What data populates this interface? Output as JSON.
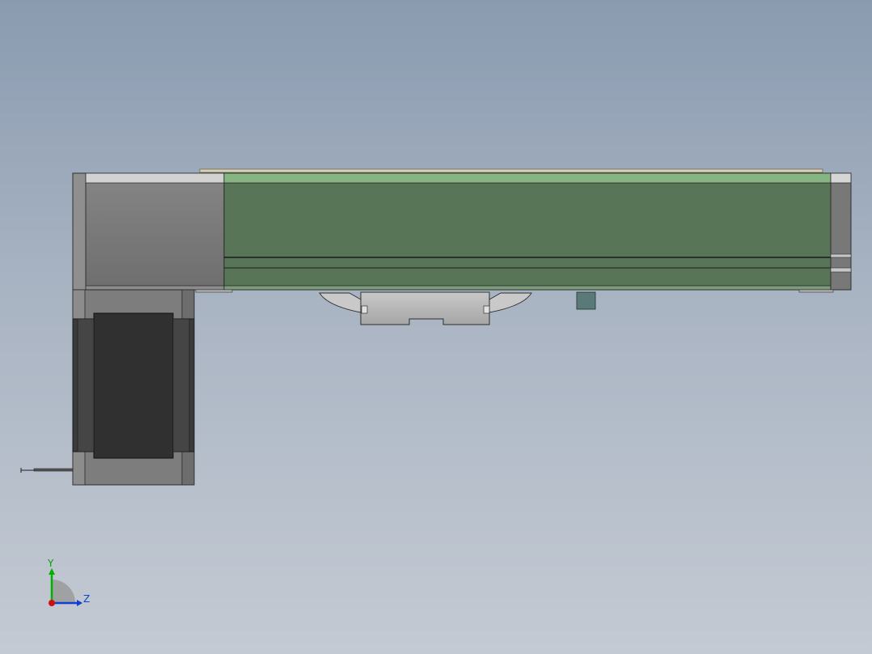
{
  "viewport": {
    "colors": {
      "background_top": "#8a9bb0",
      "background_bottom": "#c4cad3",
      "rail_green": "#587657",
      "rail_green_highlight": "#86b483",
      "body_grey": "#7a7a7a",
      "motor_dark": "#353535",
      "cover_strip": "#d8d0b0",
      "carriage_grey": "#b5b5b5",
      "sensor_teal": "#5a7a7a"
    }
  },
  "triad": {
    "y_label": "Y",
    "z_label": "Z",
    "colors": {
      "y_axis": "#00b000",
      "z_axis": "#1040d0",
      "x_axis": "#d01010",
      "quadrant": "#9a9a9a"
    }
  }
}
